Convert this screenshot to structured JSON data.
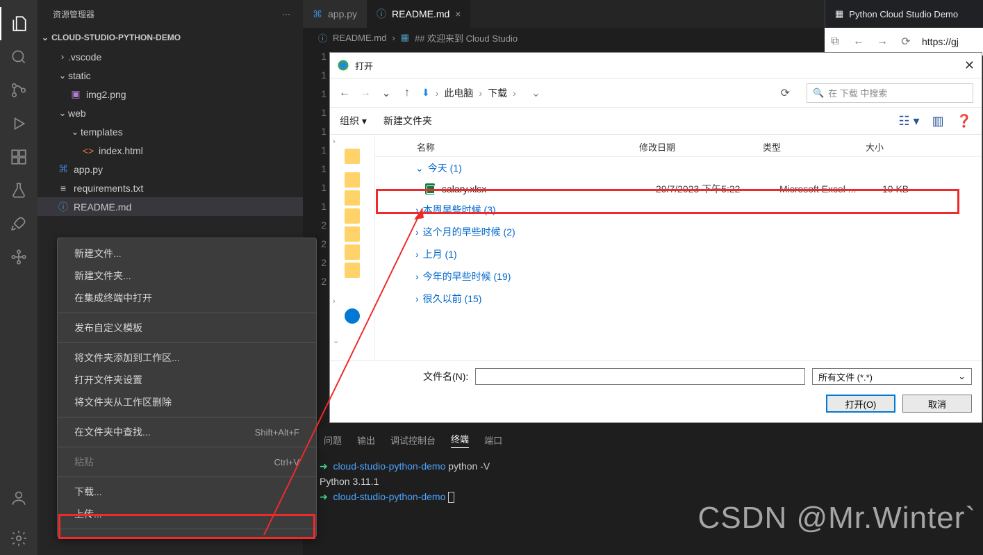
{
  "sidebar": {
    "title": "资源管理器",
    "project": "CLOUD-STUDIO-PYTHON-DEMO",
    "tree": {
      "vscode": ".vscode",
      "static": "static",
      "img2": "img2.png",
      "web": "web",
      "templates": "templates",
      "index": "index.html",
      "apppy": "app.py",
      "req": "requirements.txt",
      "readme": "README.md"
    }
  },
  "ctx": {
    "newfile": "新建文件...",
    "newfolder": "新建文件夹...",
    "openterm": "在集成终端中打开",
    "publish": "发布自定义模板",
    "addws": "将文件夹添加到工作区...",
    "wssettings": "打开文件夹设置",
    "removews": "将文件夹从工作区删除",
    "find": "在文件夹中查找...",
    "find_key": "Shift+Alt+F",
    "paste": "粘贴",
    "paste_key": "Ctrl+V",
    "download": "下载...",
    "upload": "上传..."
  },
  "tabs": {
    "app": "app.py",
    "readme": "README.md"
  },
  "crumb": {
    "file": "README.md",
    "heading": "## 欢迎来到 Cloud Studio"
  },
  "browser": {
    "tab": "Python Cloud Studio Demo",
    "url": "https://gj"
  },
  "dialog": {
    "title": "打开",
    "loc1": "此电脑",
    "loc2": "下载",
    "searchPlaceholder": "在 下载 中搜索",
    "organize": "组织",
    "newfolder": "新建文件夹",
    "col_name": "名称",
    "col_date": "修改日期",
    "col_type": "类型",
    "col_size": "大小",
    "g_today": "今天 (1)",
    "g_week": "本周早些时候 (3)",
    "g_month": "这个月的早些时候 (2)",
    "g_lastmonth": "上月 (1)",
    "g_year": "今年的早些时候 (19)",
    "g_long": "很久以前 (15)",
    "file_name": "salary.xlsx",
    "file_date": "29/7/2023 下午5:22",
    "file_type": "Microsoft Excel ...",
    "file_size": "10 KB",
    "fname_label": "文件名(N):",
    "filter": "所有文件 (*.*)",
    "open": "打开(O)",
    "cancel": "取消"
  },
  "termtabs": {
    "problems": "问题",
    "output": "输出",
    "debug": "调试控制台",
    "terminal": "终端",
    "ports": "端口"
  },
  "terminal": {
    "prompt": "cloud-studio-python-demo",
    "cmd1": "python -V",
    "out1": "Python 3.11.1"
  },
  "gutter": [
    "1",
    "",
    "1",
    "1",
    "1",
    "1",
    "1",
    "1",
    "1",
    "1",
    "2",
    "2",
    "2",
    "2"
  ],
  "watermark": "CSDN @Mr.Winter`"
}
